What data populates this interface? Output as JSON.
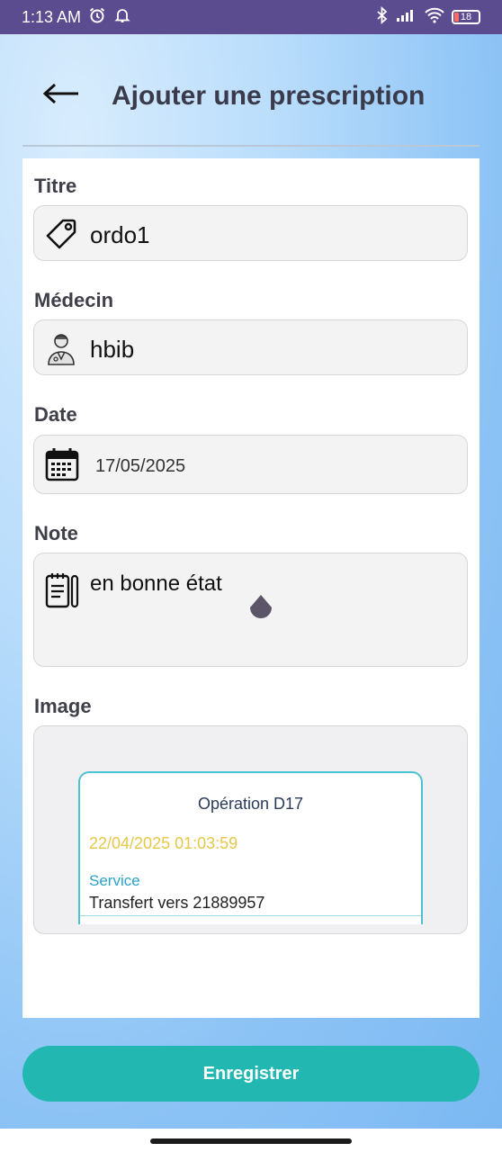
{
  "status_bar": {
    "time": "1:13 AM",
    "battery": "18",
    "icons": [
      "alarm-icon",
      "bell-icon",
      "bluetooth-icon",
      "signal-icon",
      "wifi-icon",
      "battery-icon"
    ]
  },
  "header": {
    "title": "Ajouter une prescription",
    "back_icon": "arrow-left-icon"
  },
  "form": {
    "titre": {
      "label": "Titre",
      "value": "ordo1",
      "icon": "tag-icon"
    },
    "medecin": {
      "label": "Médecin",
      "value": "hbib",
      "icon": "doctor-icon"
    },
    "date": {
      "label": "Date",
      "value": "17/05/2025",
      "icon": "calendar-icon"
    },
    "note": {
      "label": "Note",
      "value": "en bonne état",
      "icon": "notepad-icon"
    },
    "image": {
      "label": "Image",
      "preview": {
        "title": "Opération D17",
        "datetime": "22/04/2025 01:03:59",
        "service_label": "Service",
        "transfer": "Transfert vers 21889957"
      }
    }
  },
  "actions": {
    "save_label": "Enregistrer"
  },
  "colors": {
    "status_bar": "#5b4b8f",
    "accent": "#22b8b1",
    "field_bg": "#f3f3f4",
    "datetime": "#e6c74a",
    "service": "#2aa3c9"
  }
}
